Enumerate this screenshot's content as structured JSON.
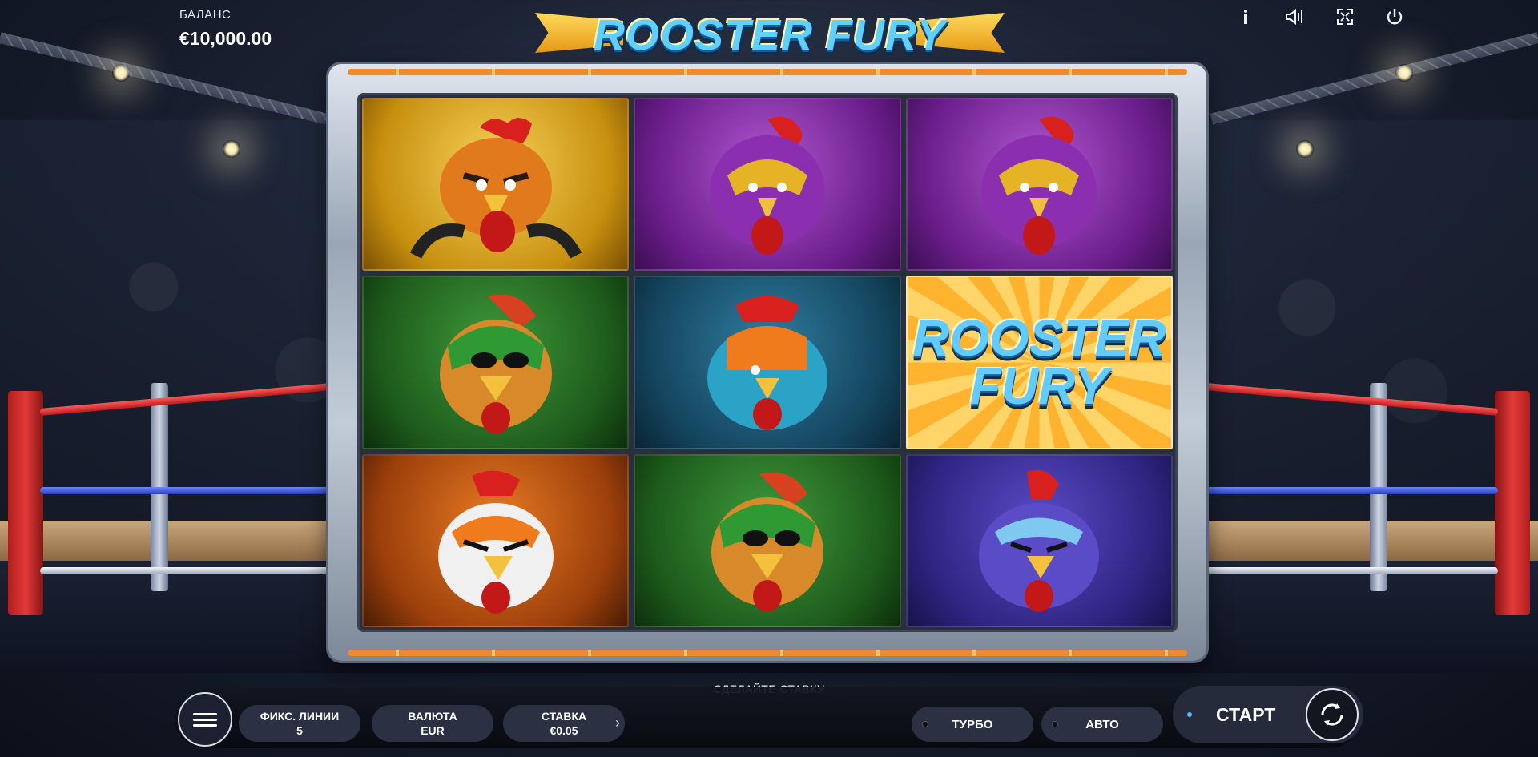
{
  "header": {
    "balance_label": "БАЛАНС",
    "balance_value": "€10,000.00",
    "logo_text": "ROOSTER FURY",
    "icons": [
      "info-icon",
      "sound-icon",
      "fullscreen-icon",
      "power-icon"
    ]
  },
  "reels": {
    "symbols": [
      [
        "orange-rooster-champ",
        "purple-masked-rooster",
        "purple-masked-rooster"
      ],
      [
        "green-masked-rooster",
        "blue-helmet-rooster",
        "rooster-fury-wild"
      ],
      [
        "orange-karate-rooster",
        "green-masked-rooster",
        "purple-angry-rooster"
      ]
    ],
    "wild_line1": "ROOSTER",
    "wild_line2": "FURY"
  },
  "controls": {
    "prompt": "СДЕЛАЙТЕ СТАВКУ",
    "lines_label": "ФИКС. ЛИНИИ",
    "lines_value": "5",
    "currency_label": "ВАЛЮТА",
    "currency_value": "EUR",
    "bet_label": "СТАВКА",
    "bet_value": "€0.05",
    "turbo_label": "ТУРБО",
    "auto_label": "АВТО",
    "start_label": "СТАРТ"
  },
  "colors": {
    "accent_blue": "#59b6ff",
    "logo_blue": "#5fd0ff",
    "frame_stripe": "#f08a2a"
  }
}
